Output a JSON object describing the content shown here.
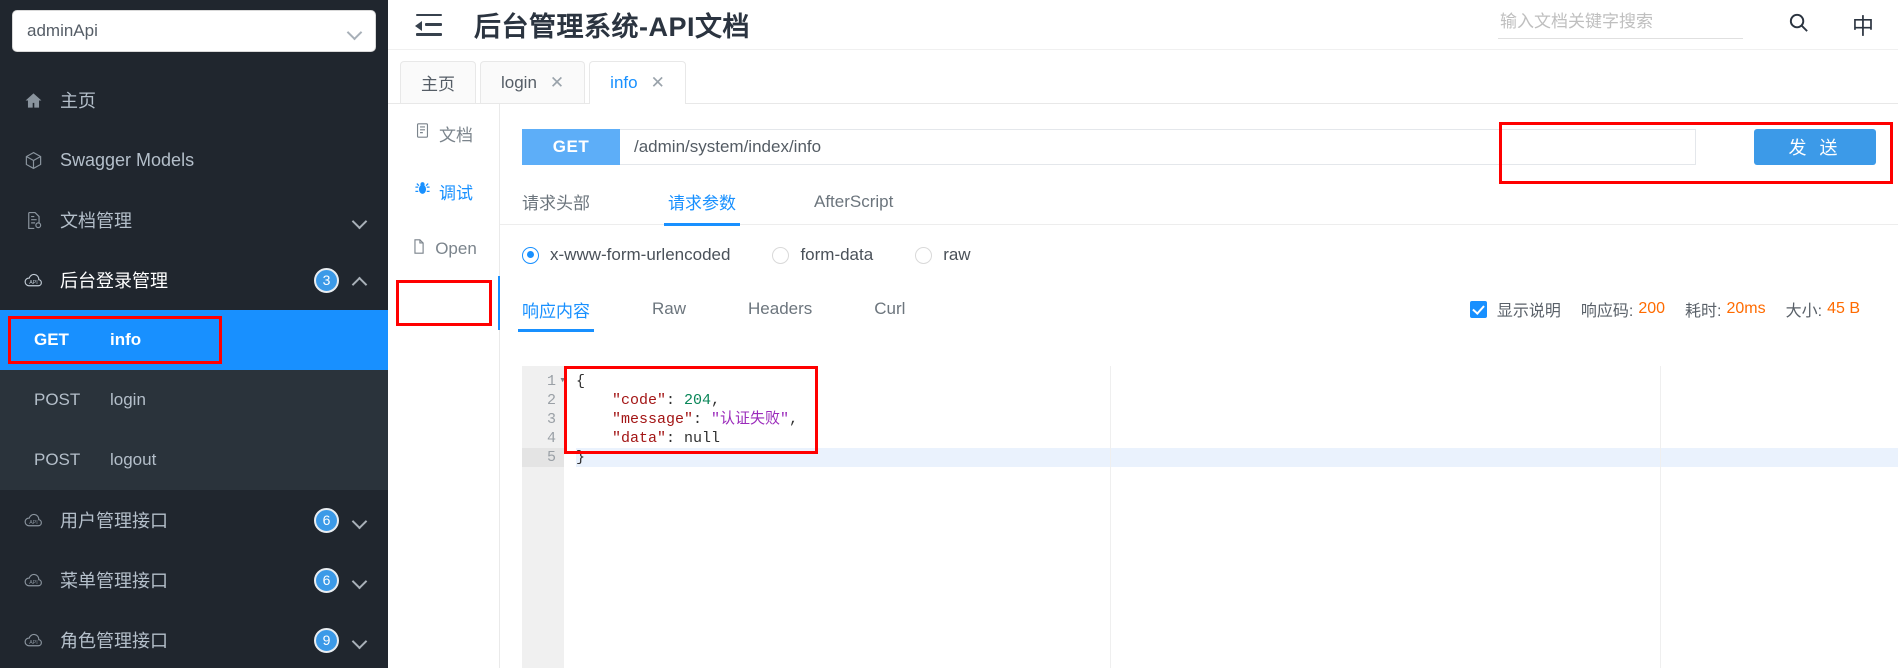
{
  "sidebar": {
    "project_select": {
      "value": "adminApi",
      "icon": "chevron-down-icon"
    },
    "items": [
      {
        "label": "主页",
        "icon": "home-icon",
        "badge": "",
        "arrow": ""
      },
      {
        "label": "Swagger Models",
        "icon": "cube-icon",
        "badge": "",
        "arrow": ""
      },
      {
        "label": "文档管理",
        "icon": "document-settings-icon",
        "badge": "",
        "arrow": "chevron-down-icon"
      },
      {
        "label": "后台登录管理",
        "icon": "api-cloud-icon",
        "badge": "3",
        "arrow": "chevron-up-icon"
      },
      {
        "label": "用户管理接口",
        "icon": "api-cloud-icon",
        "badge": "6",
        "arrow": "chevron-down-icon"
      },
      {
        "label": "菜单管理接口",
        "icon": "api-cloud-icon",
        "badge": "6",
        "arrow": "chevron-down-icon"
      },
      {
        "label": "角色管理接口",
        "icon": "api-cloud-icon",
        "badge": "9",
        "arrow": "chevron-down-icon"
      }
    ],
    "endpoints": [
      {
        "method": "GET",
        "name": "info",
        "active": true
      },
      {
        "method": "POST",
        "name": "login",
        "active": false
      },
      {
        "method": "POST",
        "name": "logout",
        "active": false
      }
    ]
  },
  "header": {
    "collapse_icon": "menu-collapse-icon",
    "title": "后台管理系统-API文档",
    "search_placeholder": "输入文档关键字搜索",
    "search_value": "",
    "search_icon": "search-icon",
    "lang_label": "中"
  },
  "tabs": [
    {
      "label": "主页",
      "closable": false,
      "active": false
    },
    {
      "label": "login",
      "closable": true,
      "active": false,
      "close": "✕"
    },
    {
      "label": "info",
      "closable": true,
      "active": true,
      "close": "✕"
    }
  ],
  "inner_nav": [
    {
      "label": "文档",
      "icon": "document-icon",
      "active": false
    },
    {
      "label": "调试",
      "icon": "bug-icon",
      "active": true
    },
    {
      "label": "Open",
      "icon": "file-icon",
      "active": false
    }
  ],
  "request": {
    "method": "GET",
    "url": "/admin/system/index/info",
    "send_label": "发 送",
    "tabs": [
      {
        "label": "请求头部",
        "active": false
      },
      {
        "label": "请求参数",
        "active": true
      },
      {
        "label": "AfterScript",
        "active": false
      }
    ],
    "body_types": [
      {
        "label": "x-www-form-urlencoded",
        "checked": true
      },
      {
        "label": "form-data",
        "checked": false
      },
      {
        "label": "raw",
        "checked": false
      }
    ]
  },
  "response": {
    "tabs": [
      {
        "label": "响应内容",
        "active": true
      },
      {
        "label": "Raw",
        "active": false
      },
      {
        "label": "Headers",
        "active": false
      },
      {
        "label": "Curl",
        "active": false
      }
    ],
    "show_description_label": "显示说明",
    "show_description_checked": true,
    "meta": [
      {
        "key": "响应码:",
        "value": "200"
      },
      {
        "key": "耗时:",
        "value": "20ms"
      },
      {
        "key": "大小:",
        "value": "45 B"
      }
    ],
    "code_lines": [
      "1",
      "2",
      "3",
      "4",
      "5"
    ],
    "body": {
      "l1": "{",
      "l2_key": "\"code\"",
      "l2_val": "204",
      "l3_key": "\"message\"",
      "l3_val": "\"认证失败\"",
      "l4_key": "\"data\"",
      "l4_val": "null",
      "l5": "}"
    }
  },
  "colors": {
    "accent": "#1890ff",
    "sidebar_bg": "#20262e",
    "sidebar_sub_bg": "#2a333b",
    "highlight": "#ff0000",
    "meta_value": "#ff6b00"
  }
}
